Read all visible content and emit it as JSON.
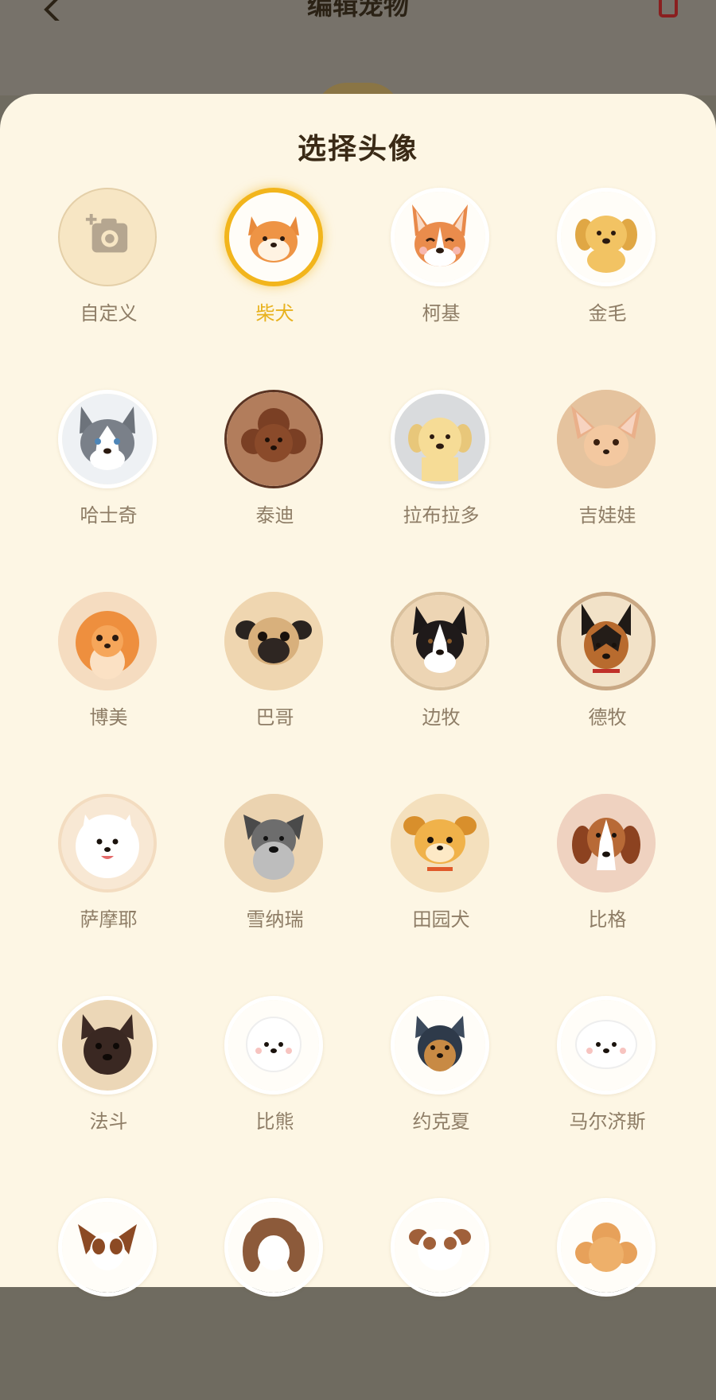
{
  "header": {
    "title": "编辑宠物"
  },
  "sheet": {
    "title": "选择头像"
  },
  "avatars": [
    {
      "label": "自定义",
      "icon": "add-photo-icon"
    },
    {
      "label": "柴犬",
      "selected": true
    },
    {
      "label": "柯基"
    },
    {
      "label": "金毛"
    },
    {
      "label": "哈士奇"
    },
    {
      "label": "泰迪"
    },
    {
      "label": "拉布拉多"
    },
    {
      "label": "吉娃娃"
    },
    {
      "label": "博美"
    },
    {
      "label": "巴哥"
    },
    {
      "label": "边牧"
    },
    {
      "label": "德牧"
    },
    {
      "label": "萨摩耶"
    },
    {
      "label": "雪纳瑞"
    },
    {
      "label": "田园犬"
    },
    {
      "label": "比格"
    },
    {
      "label": "法斗"
    },
    {
      "label": "比熊"
    },
    {
      "label": "约克夏"
    },
    {
      "label": "马尔济斯"
    },
    {
      "label": ""
    },
    {
      "label": ""
    },
    {
      "label": ""
    },
    {
      "label": ""
    }
  ],
  "colors": {
    "accent": "#f2b51c",
    "sheet_bg": "#fdf6e4",
    "label": "#8e7d66",
    "title": "#3a2a16"
  }
}
